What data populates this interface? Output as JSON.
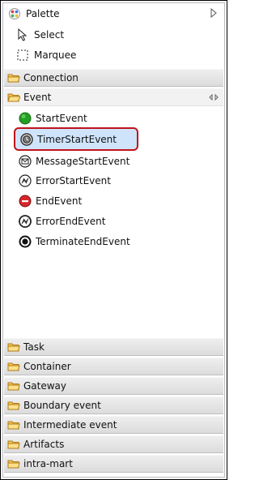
{
  "palette": {
    "title": "Palette",
    "tools": [
      {
        "label": "Select",
        "icon": "arrow-pointer-icon"
      },
      {
        "label": "Marquee",
        "icon": "marquee-icon"
      }
    ]
  },
  "drawers": {
    "connection": "Connection",
    "event": "Event",
    "task": "Task",
    "container": "Container",
    "gateway": "Gateway",
    "boundary": "Boundary event",
    "intermediate": "Intermediate event",
    "artifacts": "Artifacts",
    "intramart": "intra-mart"
  },
  "events": [
    {
      "label": "StartEvent",
      "icon": "start-event-icon"
    },
    {
      "label": "TimerStartEvent",
      "icon": "timer-start-event-icon",
      "selected": true
    },
    {
      "label": "MessageStartEvent",
      "icon": "message-start-event-icon"
    },
    {
      "label": "ErrorStartEvent",
      "icon": "error-start-event-icon"
    },
    {
      "label": "EndEvent",
      "icon": "end-event-icon"
    },
    {
      "label": "ErrorEndEvent",
      "icon": "error-end-event-icon"
    },
    {
      "label": "TerminateEndEvent",
      "icon": "terminate-end-event-icon"
    }
  ],
  "colors": {
    "selection_border": "#c0141c",
    "selection_fill": "#cfe4fb",
    "start_event": "#22a022",
    "end_event": "#d8262c"
  }
}
